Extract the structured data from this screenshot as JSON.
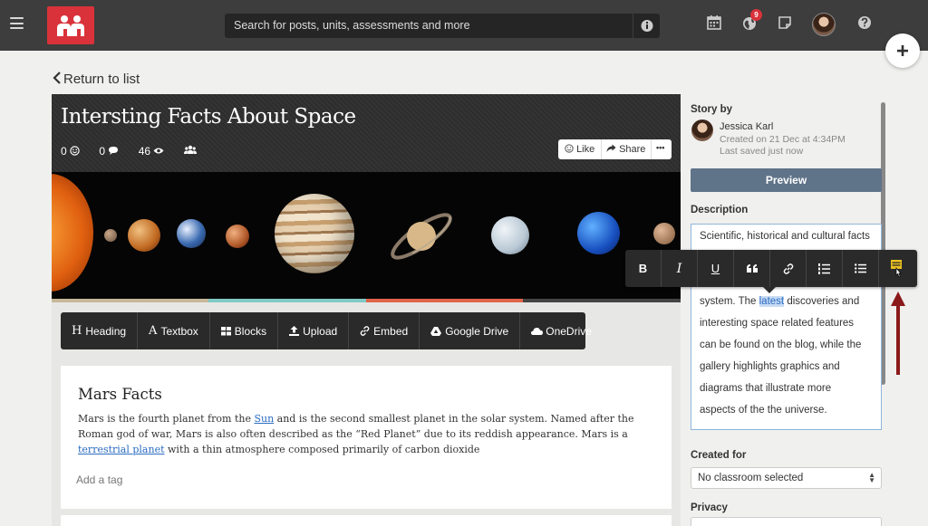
{
  "topbar": {
    "search_placeholder": "Search for posts, units, assessments and more",
    "notification_count": "9",
    "colors": {
      "bar": "#3d3d3d",
      "brand": "#d9323a"
    }
  },
  "return_link": "Return to list",
  "story": {
    "title": "Intersting Facts About Space",
    "stats": {
      "reactions": "0",
      "comments": "0",
      "views": "46"
    },
    "like_label": "Like",
    "share_label": "Share",
    "more_label": "•••",
    "toolbar": [
      "Heading",
      "Textbox",
      "Blocks",
      "Upload",
      "Embed",
      "Google Drive",
      "OneDrive"
    ],
    "block": {
      "heading": "Mars Facts",
      "p1": "Mars is the fourth planet from the ",
      "link1": "Sun",
      "p2": " and is the second smallest planet in the solar system. Named after the Roman god of war, Mars is also often described as the “Red Planet” due to its reddish appearance. Mars is a ",
      "link2": "terrestrial planet",
      "p3": " with a thin atmosphere composed primarily of carbon dioxide",
      "add_tag": "Add a tag"
    }
  },
  "panel": {
    "story_by_label": "Story by",
    "author": "Jessica Karl",
    "created": "Created on 21 Dec at 4:34PM",
    "saved": "Last saved just now",
    "preview_label": "Preview",
    "description_label": "Description",
    "description_lines": [
      "Scientific, historical and cultural facts",
      "system. The ",
      "interesting space related features",
      "can be found on the blog, while the",
      "gallery highlights graphics and",
      "diagrams that illustrate more",
      "aspects of the the universe."
    ],
    "desc_highlight": "latest",
    "desc_after_highlight": " discoveries and",
    "created_for_label": "Created for",
    "created_for_value": "No classroom selected",
    "privacy_label": "Privacy"
  },
  "format_toolbar": {
    "buttons": [
      "B",
      "I",
      "U",
      "quote-icon",
      "link-icon",
      "ordered-list-icon",
      "bullet-list-icon",
      "highlight-icon"
    ],
    "bold_label": "B",
    "italic_label": "I",
    "underline_label": "U"
  },
  "annotation_color": "#8b1a1a"
}
